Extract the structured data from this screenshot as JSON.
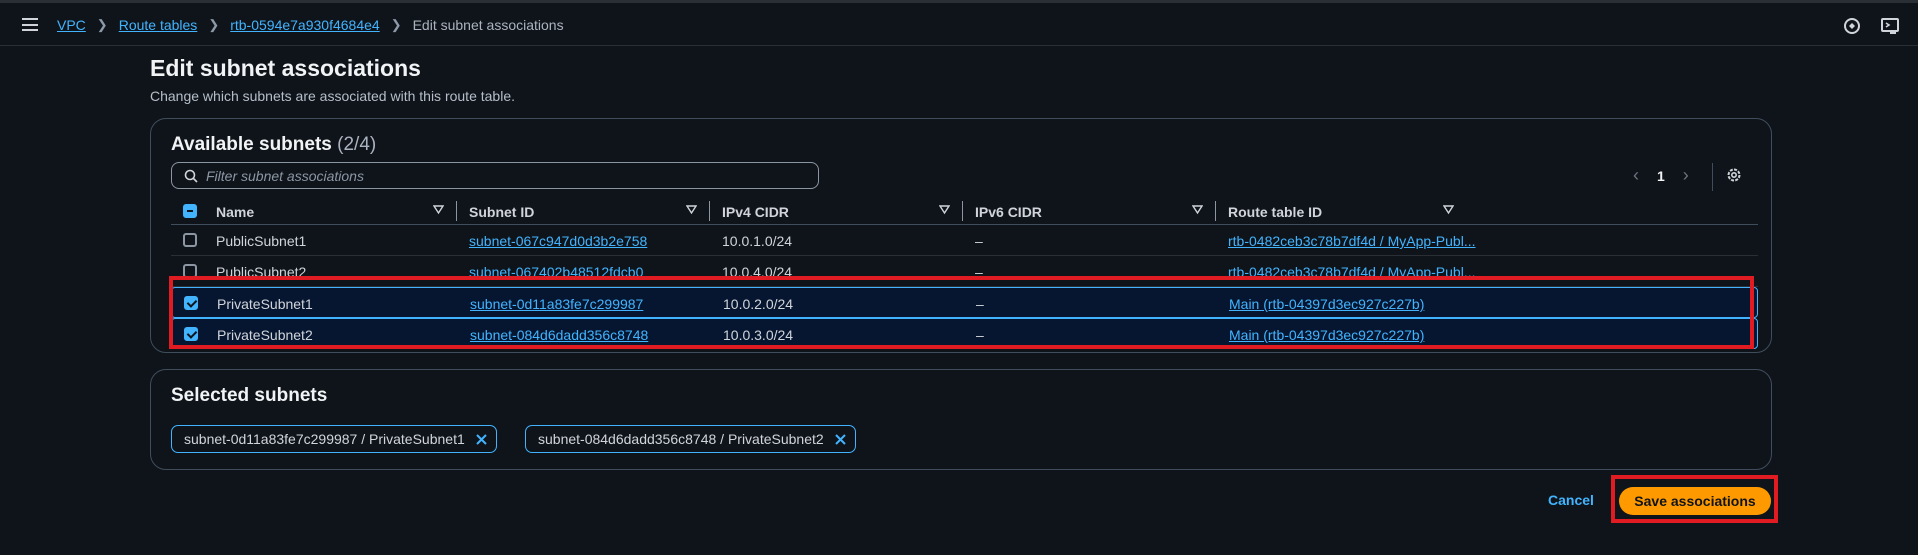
{
  "breadcrumb": {
    "vpc": "VPC",
    "route_tables": "Route tables",
    "route_table": "rtb-0594e7a930f4684e4",
    "current": "Edit subnet associations"
  },
  "page": {
    "title": "Edit subnet associations",
    "description": "Change which subnets are associated with this route table."
  },
  "available": {
    "heading": "Available subnets",
    "count": "(2/4)",
    "filter_placeholder": "Filter subnet associations",
    "page": "1",
    "columns": [
      "Name",
      "Subnet ID",
      "IPv4 CIDR",
      "IPv6 CIDR",
      "Route table ID"
    ],
    "rows": [
      {
        "checked": false,
        "name": "PublicSubnet1",
        "subnet_id": "subnet-067c947d0d3b2e758",
        "ipv4": "10.0.1.0/24",
        "ipv6": "–",
        "route_table": "rtb-0482ceb3c78b7df4d / MyApp-Publ..."
      },
      {
        "checked": false,
        "name": "PublicSubnet2",
        "subnet_id": "subnet-067402b48512fdcb0",
        "ipv4": "10.0.4.0/24",
        "ipv6": "–",
        "route_table": "rtb-0482ceb3c78b7df4d / MyApp-Publ..."
      },
      {
        "checked": true,
        "name": "PrivateSubnet1",
        "subnet_id": "subnet-0d11a83fe7c299987",
        "ipv4": "10.0.2.0/24",
        "ipv6": "–",
        "route_table": "Main (rtb-04397d3ec927c227b)"
      },
      {
        "checked": true,
        "name": "PrivateSubnet2",
        "subnet_id": "subnet-084d6dadd356c8748",
        "ipv4": "10.0.3.0/24",
        "ipv6": "–",
        "route_table": "Main (rtb-04397d3ec927c227b)"
      }
    ]
  },
  "selected": {
    "heading": "Selected subnets",
    "tokens": [
      "subnet-0d11a83fe7c299987 / PrivateSubnet1",
      "subnet-084d6dadd356c8748 / PrivateSubnet2"
    ]
  },
  "actions": {
    "cancel": "Cancel",
    "save": "Save associations"
  },
  "colors": {
    "accent": "#42b4ff",
    "primary_button": "#ff9900",
    "highlight": "#e01b22"
  }
}
